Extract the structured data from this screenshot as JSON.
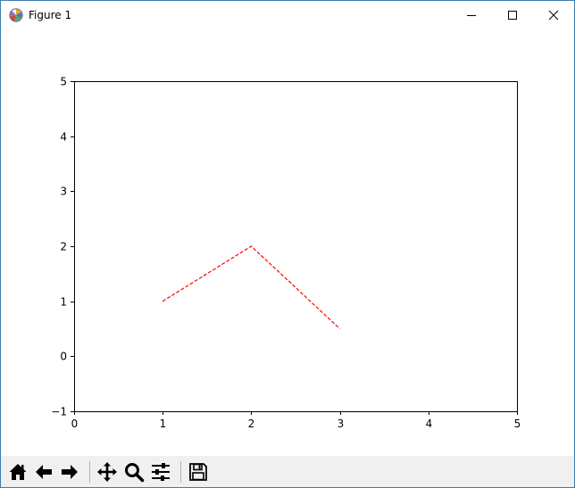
{
  "window": {
    "title": "Figure 1",
    "icon": "matplotlib-logo-icon",
    "controls": [
      "minimize-icon",
      "maximize-icon",
      "close-icon"
    ]
  },
  "chart_data": {
    "type": "line",
    "series": [
      {
        "x": [
          1,
          2,
          3
        ],
        "y": [
          1,
          2,
          0.5
        ],
        "color": "#ff0000",
        "linestyle": "dashed"
      }
    ],
    "xlim": [
      0,
      5
    ],
    "ylim": [
      -1,
      5
    ],
    "xticks": [
      "0",
      "1",
      "2",
      "3",
      "4",
      "5"
    ],
    "yticks": [
      "−1",
      "0",
      "1",
      "2",
      "3",
      "4",
      "5"
    ],
    "grid": false
  },
  "toolbar": {
    "buttons": [
      {
        "name": "home-icon"
      },
      {
        "name": "back-arrow-icon"
      },
      {
        "name": "forward-arrow-icon"
      },
      {
        "name": "pan-icon"
      },
      {
        "name": "zoom-icon"
      },
      {
        "name": "configure-subplots-icon"
      },
      {
        "name": "save-icon"
      }
    ]
  }
}
